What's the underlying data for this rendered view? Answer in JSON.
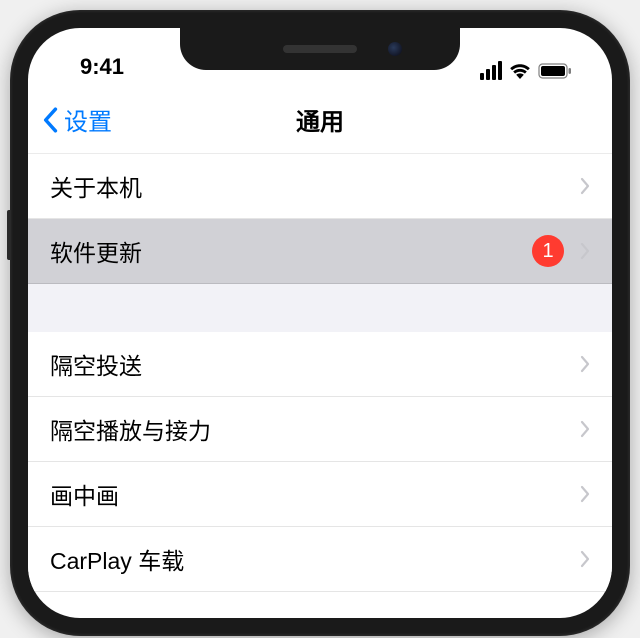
{
  "status": {
    "time": "9:41"
  },
  "nav": {
    "back_label": "设置",
    "title": "通用"
  },
  "rows": {
    "about": "关于本机",
    "software_update": "软件更新",
    "software_update_badge": "1",
    "airdrop": "隔空投送",
    "airplay_handoff": "隔空播放与接力",
    "pip": "画中画",
    "carplay": "CarPlay 车载"
  },
  "colors": {
    "accent": "#007aff",
    "badge": "#ff3b30",
    "highlight": "#d1d1d6"
  }
}
